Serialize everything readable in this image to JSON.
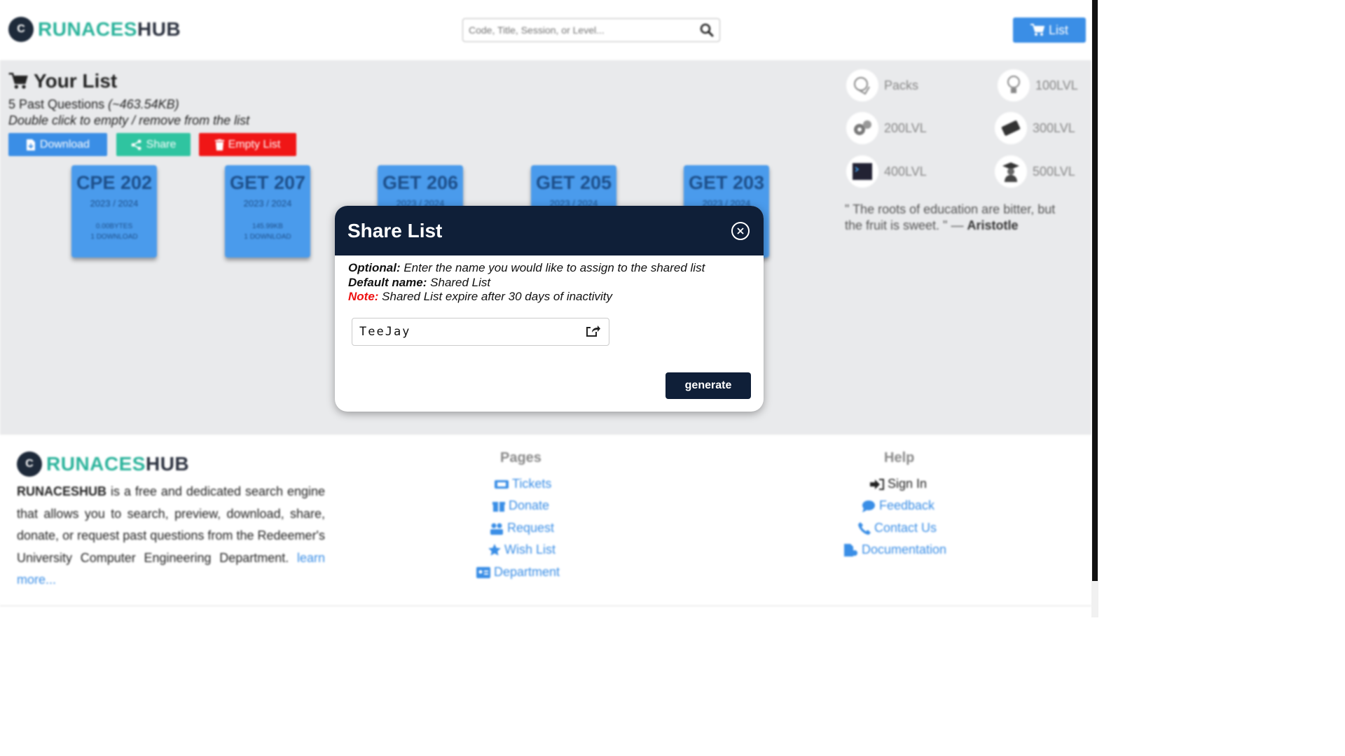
{
  "header": {
    "brand_a": "RUNACES",
    "brand_b": "HUB",
    "search_placeholder": "Code, Title, Session, or Level...",
    "list_label": "List"
  },
  "your_list": {
    "title": "Your List",
    "count_text": "5 Past Questions",
    "size_text": "(~463.54KB)",
    "hint": "Double click to empty / remove from the list",
    "download_label": "Download",
    "share_label": "Share",
    "empty_label": "Empty List"
  },
  "cards": [
    {
      "code": "CPE 202",
      "session": "2023 / 2024",
      "size": "0.00BYTES",
      "downloads": "1 DOWNLOAD"
    },
    {
      "code": "GET 207",
      "session": "2023 / 2024",
      "size": "145.99KB",
      "downloads": "1 DOWNLOAD"
    },
    {
      "code": "GET 206",
      "session": "2023 / 2024",
      "size": "",
      "downloads": ""
    },
    {
      "code": "GET 205",
      "session": "2023 / 2024",
      "size": "",
      "downloads": ""
    },
    {
      "code": "GET 203",
      "session": "2023 / 2024",
      "size": "",
      "downloads": ""
    }
  ],
  "categories": [
    {
      "label": "Packs",
      "icon": "packs-icon"
    },
    {
      "label": "100LVL",
      "icon": "bulb-icon"
    },
    {
      "label": "200LVL",
      "icon": "gears-icon"
    },
    {
      "label": "300LVL",
      "icon": "chip-icon"
    },
    {
      "label": "400LVL",
      "icon": "terminal-icon"
    },
    {
      "label": "500LVL",
      "icon": "graduate-icon"
    }
  ],
  "quote": {
    "text": "\" The roots of education are bitter, but the fruit is sweet. \" — ",
    "author": "Aristotle"
  },
  "footer": {
    "brand_a": "RUNACES",
    "brand_b": "HUB",
    "desc_brand": "RUNACESHUB",
    "desc": " is a free and dedicated search engine that allows you to search, preview, download, share, donate, or request past questions from the Redeemer's University Computer Engineering Department. ",
    "learn_more": "learn more...",
    "pages_title": "Pages",
    "pages": [
      "Tickets",
      "Donate",
      "Request",
      "Wish List",
      "Department"
    ],
    "help_title": "Help",
    "help": [
      "Sign In",
      "Feedback",
      "Contact Us",
      "Documentation"
    ]
  },
  "modal": {
    "title": "Share List",
    "optional_label": "Optional:",
    "optional_text": " Enter the name you would like to assign to the shared list",
    "default_label": "Default name:",
    "default_text": " Shared List",
    "note_label": "Note:",
    "note_text": " Shared List expire after 30 days of inactivity",
    "name_value": "TeeJay",
    "generate_label": "generate"
  },
  "colors": {
    "primary_blue": "#3a8ee6",
    "share_green": "#2fc4a0",
    "danger_red": "#f01616",
    "modal_navy": "#0f1f38",
    "brand_teal": "#2bb39b"
  }
}
